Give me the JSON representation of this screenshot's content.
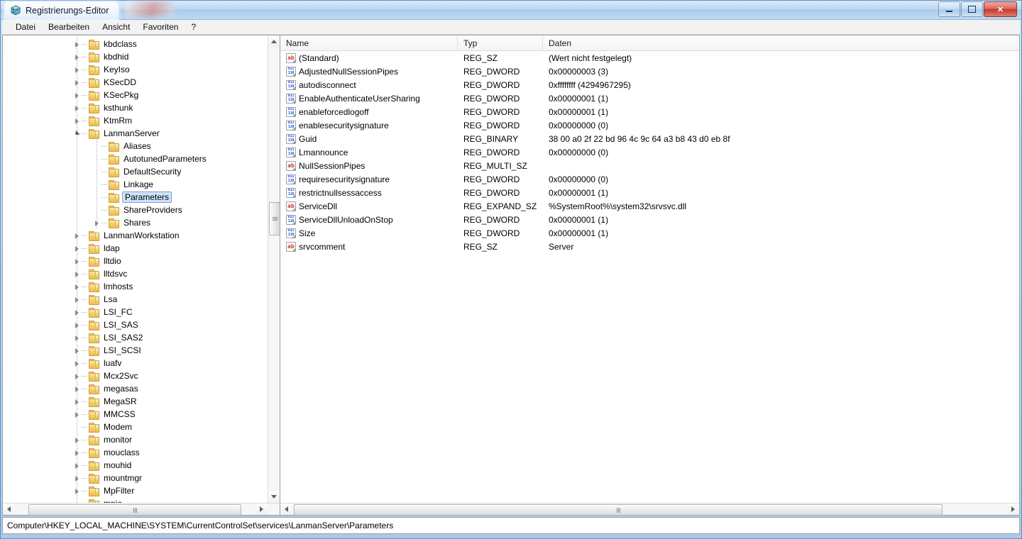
{
  "window": {
    "title": "Registrierungs-Editor",
    "icon": "registry-editor-icon",
    "controls": {
      "minimize": "Minimieren",
      "restore": "Wiederherstellen",
      "close": "Schließen"
    }
  },
  "menu": {
    "items": [
      "Datei",
      "Bearbeiten",
      "Ansicht",
      "Favoriten",
      "?"
    ]
  },
  "tree": {
    "selected": "Parameters",
    "nodes": [
      {
        "label": "kbdclass",
        "depth": 1,
        "expander": "collapsed"
      },
      {
        "label": "kbdhid",
        "depth": 1,
        "expander": "collapsed"
      },
      {
        "label": "KeyIso",
        "depth": 1,
        "expander": "collapsed"
      },
      {
        "label": "KSecDD",
        "depth": 1,
        "expander": "collapsed"
      },
      {
        "label": "KSecPkg",
        "depth": 1,
        "expander": "collapsed"
      },
      {
        "label": "ksthunk",
        "depth": 1,
        "expander": "collapsed"
      },
      {
        "label": "KtmRm",
        "depth": 1,
        "expander": "collapsed"
      },
      {
        "label": "LanmanServer",
        "depth": 1,
        "expander": "expanded"
      },
      {
        "label": "Aliases",
        "depth": 2,
        "expander": "none"
      },
      {
        "label": "AutotunedParameters",
        "depth": 2,
        "expander": "none"
      },
      {
        "label": "DefaultSecurity",
        "depth": 2,
        "expander": "none"
      },
      {
        "label": "Linkage",
        "depth": 2,
        "expander": "none"
      },
      {
        "label": "Parameters",
        "depth": 2,
        "expander": "none",
        "selected": true
      },
      {
        "label": "ShareProviders",
        "depth": 2,
        "expander": "none"
      },
      {
        "label": "Shares",
        "depth": 2,
        "expander": "collapsed"
      },
      {
        "label": "LanmanWorkstation",
        "depth": 1,
        "expander": "collapsed"
      },
      {
        "label": "ldap",
        "depth": 1,
        "expander": "collapsed"
      },
      {
        "label": "lltdio",
        "depth": 1,
        "expander": "collapsed"
      },
      {
        "label": "lltdsvc",
        "depth": 1,
        "expander": "collapsed"
      },
      {
        "label": "lmhosts",
        "depth": 1,
        "expander": "collapsed"
      },
      {
        "label": "Lsa",
        "depth": 1,
        "expander": "collapsed"
      },
      {
        "label": "LSI_FC",
        "depth": 1,
        "expander": "collapsed"
      },
      {
        "label": "LSI_SAS",
        "depth": 1,
        "expander": "collapsed"
      },
      {
        "label": "LSI_SAS2",
        "depth": 1,
        "expander": "collapsed"
      },
      {
        "label": "LSI_SCSI",
        "depth": 1,
        "expander": "collapsed"
      },
      {
        "label": "luafv",
        "depth": 1,
        "expander": "collapsed"
      },
      {
        "label": "Mcx2Svc",
        "depth": 1,
        "expander": "collapsed"
      },
      {
        "label": "megasas",
        "depth": 1,
        "expander": "collapsed"
      },
      {
        "label": "MegaSR",
        "depth": 1,
        "expander": "collapsed"
      },
      {
        "label": "MMCSS",
        "depth": 1,
        "expander": "collapsed"
      },
      {
        "label": "Modem",
        "depth": 1,
        "expander": "none"
      },
      {
        "label": "monitor",
        "depth": 1,
        "expander": "collapsed"
      },
      {
        "label": "mouclass",
        "depth": 1,
        "expander": "collapsed"
      },
      {
        "label": "mouhid",
        "depth": 1,
        "expander": "collapsed"
      },
      {
        "label": "mountmgr",
        "depth": 1,
        "expander": "collapsed"
      },
      {
        "label": "MpFilter",
        "depth": 1,
        "expander": "collapsed"
      },
      {
        "label": "mpio",
        "depth": 1,
        "expander": "none"
      }
    ]
  },
  "list": {
    "columns": [
      "Name",
      "Typ",
      "Daten"
    ],
    "rows": [
      {
        "name": "(Standard)",
        "type": "REG_SZ",
        "data": "(Wert nicht festgelegt)",
        "icon": "string-value-icon"
      },
      {
        "name": "AdjustedNullSessionPipes",
        "type": "REG_DWORD",
        "data": "0x00000003 (3)",
        "icon": "dword-value-icon"
      },
      {
        "name": "autodisconnect",
        "type": "REG_DWORD",
        "data": "0xffffffff (4294967295)",
        "icon": "dword-value-icon"
      },
      {
        "name": "EnableAuthenticateUserSharing",
        "type": "REG_DWORD",
        "data": "0x00000001 (1)",
        "icon": "dword-value-icon"
      },
      {
        "name": "enableforcedlogoff",
        "type": "REG_DWORD",
        "data": "0x00000001 (1)",
        "icon": "dword-value-icon"
      },
      {
        "name": "enablesecuritysignature",
        "type": "REG_DWORD",
        "data": "0x00000000 (0)",
        "icon": "dword-value-icon"
      },
      {
        "name": "Guid",
        "type": "REG_BINARY",
        "data": "38 00 a0 2f 22 bd 96 4c 9c 64 a3 b8 43 d0 eb 8f",
        "icon": "dword-value-icon"
      },
      {
        "name": "Lmannounce",
        "type": "REG_DWORD",
        "data": "0x00000000 (0)",
        "icon": "dword-value-icon"
      },
      {
        "name": "NullSessionPipes",
        "type": "REG_MULTI_SZ",
        "data": "",
        "icon": "string-value-icon"
      },
      {
        "name": "requiresecuritysignature",
        "type": "REG_DWORD",
        "data": "0x00000000 (0)",
        "icon": "dword-value-icon"
      },
      {
        "name": "restrictnullsessaccess",
        "type": "REG_DWORD",
        "data": "0x00000001 (1)",
        "icon": "dword-value-icon"
      },
      {
        "name": "ServiceDll",
        "type": "REG_EXPAND_SZ",
        "data": "%SystemRoot%\\system32\\srvsvc.dll",
        "icon": "string-value-icon"
      },
      {
        "name": "ServiceDllUnloadOnStop",
        "type": "REG_DWORD",
        "data": "0x00000001 (1)",
        "icon": "dword-value-icon"
      },
      {
        "name": "Size",
        "type": "REG_DWORD",
        "data": "0x00000001 (1)",
        "icon": "dword-value-icon"
      },
      {
        "name": "srvcomment",
        "type": "REG_SZ",
        "data": "Server",
        "icon": "string-value-icon"
      }
    ]
  },
  "statusbar": {
    "path": "Computer\\HKEY_LOCAL_MACHINE\\SYSTEM\\CurrentControlSet\\services\\LanmanServer\\Parameters"
  }
}
